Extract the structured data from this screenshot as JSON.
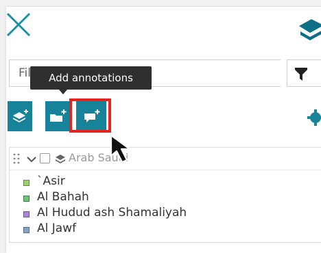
{
  "tooltip": {
    "text": "Add annotations"
  },
  "filter": {
    "placeholder": "Filter"
  },
  "icons": {
    "close": "close-icon",
    "layers": "layers-icon",
    "filter": "funnel-icon",
    "add_layer": "layers-plus-icon",
    "add_folder": "folder-plus-icon",
    "add_annotation": "comment-plus-icon",
    "settings": "gear-icon"
  },
  "colors": {
    "accent": "#17839a",
    "highlight": "#e6231f",
    "tooltip_bg": "#2f2f2f"
  },
  "layer": {
    "name": "Arab Saudi",
    "legend": [
      {
        "label": "`Asir",
        "color": "#9ccf6e"
      },
      {
        "label": "Al Bahah",
        "color": "#6fc27a"
      },
      {
        "label": "Al Hudud ash Shamaliyah",
        "color": "#a987d6"
      },
      {
        "label": "Al Jawf",
        "color": "#8aa1c9"
      }
    ]
  }
}
